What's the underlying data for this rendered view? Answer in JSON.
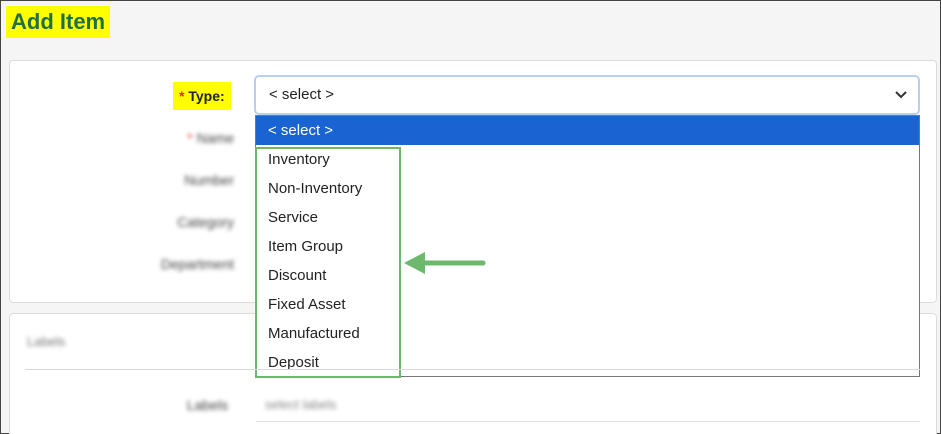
{
  "page": {
    "title": "Add Item"
  },
  "form": {
    "type_label": "Type:",
    "type_required": "*",
    "name_required": "*",
    "name_label": "Name",
    "number_label": "Number",
    "category_label": "Category",
    "department_label": "Department"
  },
  "select": {
    "value": "< select >",
    "icon": "chevron-down-icon",
    "options": [
      {
        "label": "< select >",
        "selected": true
      },
      {
        "label": "Inventory"
      },
      {
        "label": "Non-Inventory"
      },
      {
        "label": "Service"
      },
      {
        "label": "Item Group"
      },
      {
        "label": "Discount"
      },
      {
        "label": "Fixed Asset"
      },
      {
        "label": "Manufactured"
      },
      {
        "label": "Deposit"
      }
    ]
  },
  "labels_section": {
    "title": "Labels",
    "field_label": "Labels",
    "value": "select labels"
  },
  "colors": {
    "highlight": "#ffff00",
    "title_text": "#1f6f43",
    "selected_option": "#1a63d2",
    "annotation_green": "#6cb86c",
    "required": "#d9302a"
  }
}
